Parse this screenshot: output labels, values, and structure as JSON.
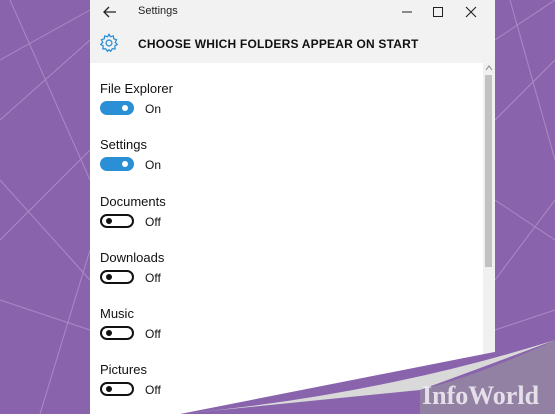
{
  "window": {
    "title": "Settings",
    "back_icon": "back-arrow-icon",
    "controls": [
      "minimize-icon",
      "maximize-icon",
      "close-icon"
    ]
  },
  "header": {
    "icon": "gear-icon",
    "title": "CHOOSE WHICH FOLDERS APPEAR ON START"
  },
  "folders": [
    {
      "label": "File Explorer",
      "state": "On",
      "on": true
    },
    {
      "label": "Settings",
      "state": "On",
      "on": true
    },
    {
      "label": "Documents",
      "state": "Off",
      "on": false
    },
    {
      "label": "Downloads",
      "state": "Off",
      "on": false
    },
    {
      "label": "Music",
      "state": "Off",
      "on": false
    },
    {
      "label": "Pictures",
      "state": "Off",
      "on": false
    }
  ],
  "colors": {
    "accent": "#2b8fd6",
    "background": "#8a63ad"
  },
  "watermark": "InfoWorld"
}
